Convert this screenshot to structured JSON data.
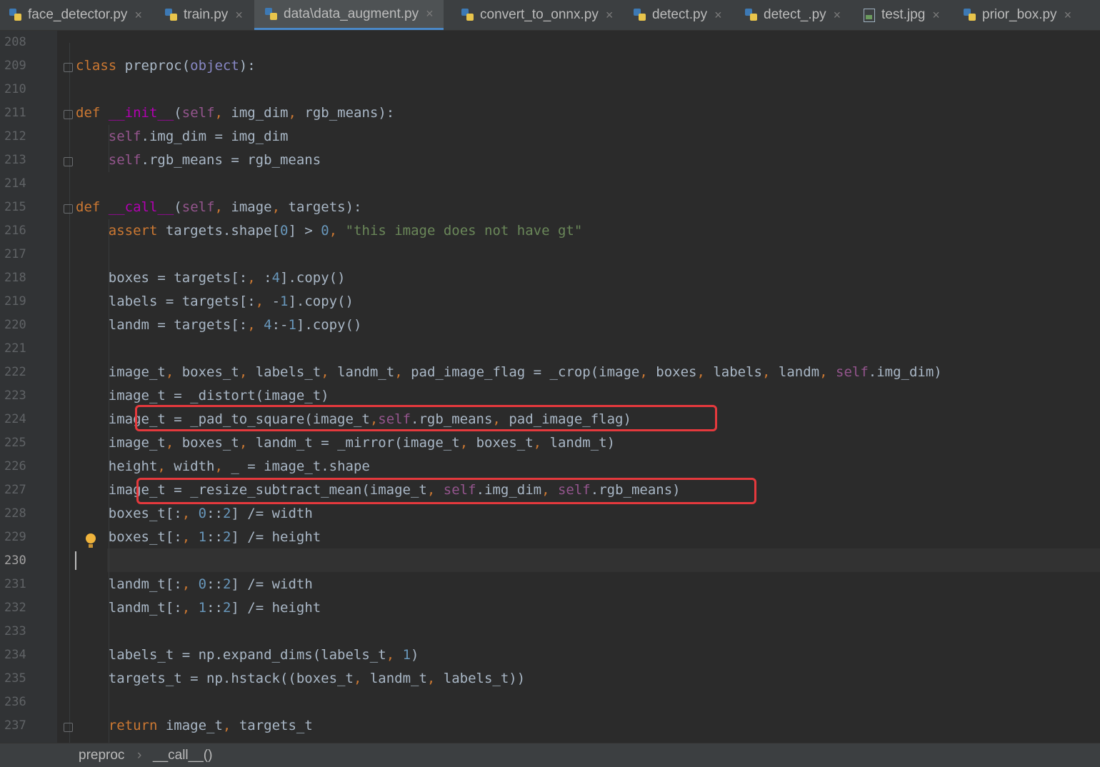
{
  "tabs": [
    {
      "label": "face_detector.py",
      "icon": "python-file-icon",
      "active": false
    },
    {
      "label": "train.py",
      "icon": "python-file-icon",
      "active": false
    },
    {
      "label": "data\\data_augment.py",
      "icon": "python-file-icon",
      "active": true
    },
    {
      "label": "convert_to_onnx.py",
      "icon": "python-file-icon",
      "active": false
    },
    {
      "label": "detect.py",
      "icon": "python-file-icon",
      "active": false
    },
    {
      "label": "detect_.py",
      "icon": "python-file-icon",
      "active": false
    },
    {
      "label": "test.jpg",
      "icon": "image-file-icon",
      "active": false
    },
    {
      "label": "prior_box.py",
      "icon": "python-file-icon",
      "active": false
    }
  ],
  "tab_close_glyph": "×",
  "editor": {
    "current_line": 230,
    "lines": [
      {
        "num": "208",
        "text": ""
      },
      {
        "num": "209",
        "text": "class preproc(object):"
      },
      {
        "num": "210",
        "text": ""
      },
      {
        "num": "211",
        "text": "    def __init__(self, img_dim, rgb_means):"
      },
      {
        "num": "212",
        "text": "        self.img_dim = img_dim"
      },
      {
        "num": "213",
        "text": "        self.rgb_means = rgb_means"
      },
      {
        "num": "214",
        "text": ""
      },
      {
        "num": "215",
        "text": "    def __call__(self, image, targets):"
      },
      {
        "num": "216",
        "text": "        assert targets.shape[0] > 0, \"this image does not have gt\""
      },
      {
        "num": "217",
        "text": ""
      },
      {
        "num": "218",
        "text": "        boxes = targets[:, :4].copy()"
      },
      {
        "num": "219",
        "text": "        labels = targets[:, -1].copy()"
      },
      {
        "num": "220",
        "text": "        landm = targets[:, 4:-1].copy()"
      },
      {
        "num": "221",
        "text": ""
      },
      {
        "num": "222",
        "text": "        image_t, boxes_t, labels_t, landm_t, pad_image_flag = _crop(image, boxes, labels, landm, self.img_dim)"
      },
      {
        "num": "223",
        "text": "        image_t = _distort(image_t)"
      },
      {
        "num": "224",
        "text": "        image_t = _pad_to_square(image_t,self.rgb_means, pad_image_flag)"
      },
      {
        "num": "225",
        "text": "        image_t, boxes_t, landm_t = _mirror(image_t, boxes_t, landm_t)"
      },
      {
        "num": "226",
        "text": "        height, width, _ = image_t.shape"
      },
      {
        "num": "227",
        "text": "        image_t = _resize_subtract_mean(image_t, self.img_dim, self.rgb_means)"
      },
      {
        "num": "228",
        "text": "        boxes_t[:, 0::2] /= width"
      },
      {
        "num": "229",
        "text": "        boxes_t[:, 1::2] /= height"
      },
      {
        "num": "230",
        "text": ""
      },
      {
        "num": "231",
        "text": "        landm_t[:, 0::2] /= width"
      },
      {
        "num": "232",
        "text": "        landm_t[:, 1::2] /= height"
      },
      {
        "num": "233",
        "text": ""
      },
      {
        "num": "234",
        "text": "        labels_t = np.expand_dims(labels_t, 1)"
      },
      {
        "num": "235",
        "text": "        targets_t = np.hstack((boxes_t, landm_t, labels_t))"
      },
      {
        "num": "236",
        "text": ""
      },
      {
        "num": "237",
        "text": "        return image_t, targets_t"
      }
    ]
  },
  "highlight_color": "#e5393d",
  "breadcrumb": {
    "items": [
      "preproc",
      "__call__()"
    ],
    "separator": "›"
  }
}
